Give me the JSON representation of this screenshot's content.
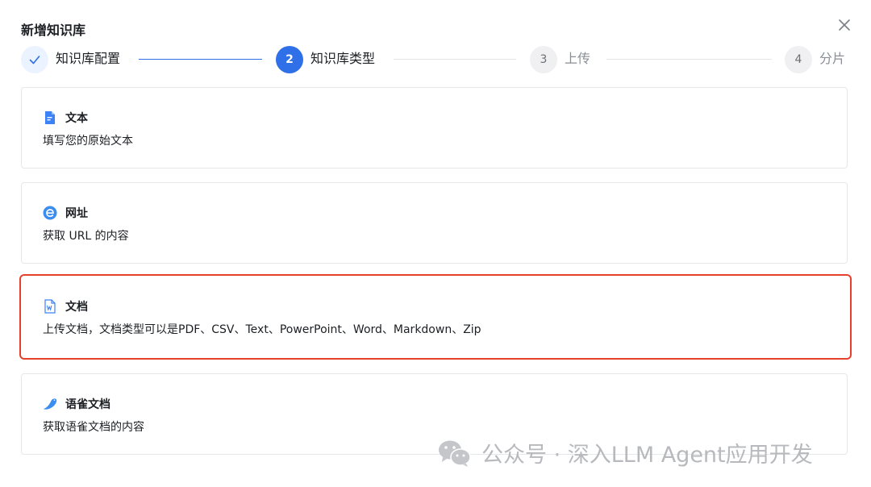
{
  "dialog": {
    "title": "新增知识库"
  },
  "steps": [
    {
      "number": "1",
      "label": "知识库配置",
      "state": "done"
    },
    {
      "number": "2",
      "label": "知识库类型",
      "state": "active"
    },
    {
      "number": "3",
      "label": "上传",
      "state": "pending"
    },
    {
      "number": "4",
      "label": "分片",
      "state": "pending"
    }
  ],
  "options": [
    {
      "icon": "text-file-icon",
      "title": "文本",
      "desc": "填写您的原始文本",
      "selected": false
    },
    {
      "icon": "web-globe-icon",
      "title": "网址",
      "desc": "获取 URL 的内容",
      "selected": false
    },
    {
      "icon": "word-document-icon",
      "title": "文档",
      "desc": "上传文档，文档类型可以是PDF、CSV、Text、PowerPoint、Word、Markdown、Zip",
      "selected": true
    },
    {
      "icon": "yuque-bird-icon",
      "title": "语雀文档",
      "desc": "获取语雀文档的内容",
      "selected": false
    }
  ],
  "watermark": {
    "text": "公众号 · 深入LLM Agent应用开发",
    "icon": "wechat-icon"
  },
  "colors": {
    "primary": "#2f6fe8",
    "highlight": "#e5412d"
  }
}
